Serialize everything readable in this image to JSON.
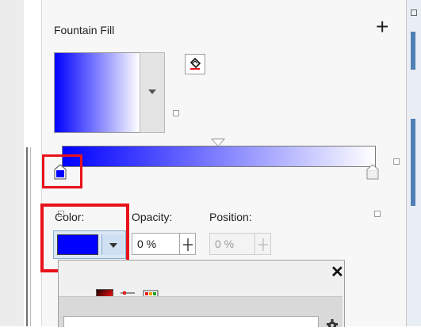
{
  "panel": {
    "title": "Fountain Fill",
    "add_label": "+"
  },
  "gradient": {
    "start_color": "#0000FF",
    "end_color": "#FFFFFF",
    "midpoint": 0.5
  },
  "node_properties": {
    "color_label": "Color:",
    "color_value": "#0000FF",
    "opacity_label": "Opacity:",
    "opacity_value": "0 %",
    "position_label": "Position:",
    "position_value": "0 %"
  },
  "color_popup": {
    "close_label": "✕",
    "modes": [
      "color-viewer-icon",
      "color-sliders-icon",
      "color-palettes-icon"
    ]
  },
  "highlight_color": "#E8121A"
}
